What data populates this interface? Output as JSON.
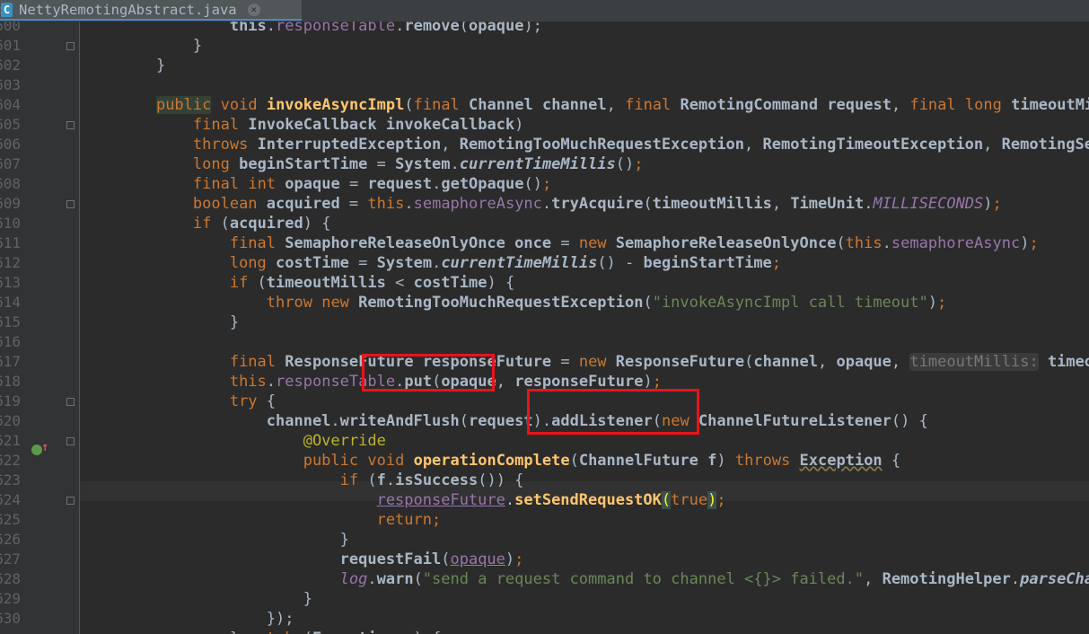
{
  "tab": {
    "file_icon": "C",
    "file_icon_name": "java-class-icon",
    "label": "NettyRemotingAbstract.java",
    "close": "×",
    "close_icon_name": "close-icon"
  },
  "line_numbers": [
    "600",
    "601",
    "602",
    "603",
    "604",
    "605",
    "606",
    "607",
    "608",
    "609",
    "610",
    "611",
    "612",
    "613",
    "614",
    "615",
    "616",
    "617",
    "618",
    "619",
    "620",
    "621",
    "622",
    "623",
    "624",
    "625",
    "626",
    "627",
    "628",
    "629",
    "630"
  ],
  "gutter": {
    "override_marker_icon": "override-method-icon"
  },
  "theme": {
    "background": "#2b2b2b",
    "keyword": "#cc7832",
    "field": "#9876aa",
    "string": "#6a8759",
    "method": "#ffc66d",
    "annotation": "#bbb529",
    "annotation_box": "#e8141a"
  },
  "code_lines": [
    [
      [
        "",
        "            "
      ],
      [
        "",
        "this"
      ],
      [
        "",
        "."
      ],
      [
        "f",
        "responseTable"
      ],
      [
        "",
        "."
      ],
      [
        "",
        "remove"
      ],
      [
        "",
        "("
      ],
      [
        "",
        "opaque"
      ],
      [
        "",
        ");"
      ]
    ],
    [
      [
        "",
        "        }"
      ]
    ],
    [
      [
        "",
        "    }"
      ]
    ],
    [],
    [
      [
        "",
        "    "
      ],
      [
        "k hl",
        "public"
      ],
      [
        "",
        " "
      ],
      [
        "k",
        "void"
      ],
      [
        "",
        " "
      ],
      [
        "m",
        "invokeAsyncImpl"
      ],
      [
        "",
        "("
      ],
      [
        "k",
        "final"
      ],
      [
        "",
        " "
      ],
      [
        "",
        "Channel"
      ],
      [
        "",
        " "
      ],
      [
        "",
        "channel"
      ],
      [
        "",
        ", "
      ],
      [
        "k",
        "final"
      ],
      [
        "",
        " "
      ],
      [
        "",
        "RemotingCommand"
      ],
      [
        "",
        " "
      ],
      [
        "",
        "request"
      ],
      [
        "",
        ", "
      ],
      [
        "k",
        "final"
      ],
      [
        "",
        " "
      ],
      [
        "k",
        "long"
      ],
      [
        "",
        " "
      ],
      [
        "",
        "timeoutMillis"
      ],
      [
        "",
        ","
      ]
    ],
    [
      [
        "",
        "        "
      ],
      [
        "k",
        "final"
      ],
      [
        "",
        " "
      ],
      [
        "",
        "InvokeCallback"
      ],
      [
        "",
        " "
      ],
      [
        "",
        "invokeCallback"
      ],
      [
        "",
        ")"
      ]
    ],
    [
      [
        "",
        "        "
      ],
      [
        "k",
        "throws"
      ],
      [
        "",
        " "
      ],
      [
        "",
        "InterruptedException"
      ],
      [
        "",
        ", "
      ],
      [
        "",
        "RemotingTooMuchRequestException"
      ],
      [
        "",
        ", "
      ],
      [
        "",
        "RemotingTimeoutException"
      ],
      [
        "",
        ", "
      ],
      [
        "",
        "RemotingSendRequestException"
      ],
      [
        "",
        " {"
      ]
    ],
    [
      [
        "",
        "        "
      ],
      [
        "k",
        "long"
      ],
      [
        "",
        " "
      ],
      [
        "",
        "beginStartTime"
      ],
      [
        "",
        " = "
      ],
      [
        "",
        "System"
      ],
      [
        "",
        "."
      ],
      [
        "it",
        "currentTimeMillis"
      ],
      [
        "",
        "()"
      ],
      [
        "k",
        ";"
      ]
    ],
    [
      [
        "",
        "        "
      ],
      [
        "k",
        "final"
      ],
      [
        "",
        " "
      ],
      [
        "k",
        "int"
      ],
      [
        "",
        " "
      ],
      [
        "",
        "opaque"
      ],
      [
        "",
        " = "
      ],
      [
        "",
        "request"
      ],
      [
        "",
        "."
      ],
      [
        "",
        "getOpaque"
      ],
      [
        "",
        "()"
      ],
      [
        "k",
        ";"
      ]
    ],
    [
      [
        "",
        "        "
      ],
      [
        "k",
        "boolean"
      ],
      [
        "",
        " "
      ],
      [
        "",
        "acquired"
      ],
      [
        "",
        " = "
      ],
      [
        "k",
        "this"
      ],
      [
        "",
        "."
      ],
      [
        "f",
        "semaphoreAsync"
      ],
      [
        "",
        "."
      ],
      [
        "",
        "tryAcquire"
      ],
      [
        "",
        "("
      ],
      [
        "",
        "timeoutMillis"
      ],
      [
        "",
        ", "
      ],
      [
        "",
        "TimeUnit"
      ],
      [
        "",
        "."
      ],
      [
        "sf",
        "MILLISECONDS"
      ],
      [
        "",
        ")"
      ],
      [
        "k",
        ";"
      ]
    ],
    [
      [
        "",
        "        "
      ],
      [
        "k",
        "if"
      ],
      [
        "",
        " ("
      ],
      [
        "",
        "acquired"
      ],
      [
        "",
        ") {"
      ]
    ],
    [
      [
        "",
        "            "
      ],
      [
        "k",
        "final"
      ],
      [
        "",
        " "
      ],
      [
        "",
        "SemaphoreReleaseOnlyOnce"
      ],
      [
        "",
        " "
      ],
      [
        "",
        "once"
      ],
      [
        "",
        " = "
      ],
      [
        "k",
        "new"
      ],
      [
        "",
        " "
      ],
      [
        "",
        "SemaphoreReleaseOnlyOnce"
      ],
      [
        "",
        "("
      ],
      [
        "k",
        "this"
      ],
      [
        "",
        "."
      ],
      [
        "f",
        "semaphoreAsync"
      ],
      [
        "",
        ")"
      ],
      [
        "k",
        ";"
      ]
    ],
    [
      [
        "",
        "            "
      ],
      [
        "k",
        "long"
      ],
      [
        "",
        " "
      ],
      [
        "",
        "costTime"
      ],
      [
        "",
        " = "
      ],
      [
        "",
        "System"
      ],
      [
        "",
        "."
      ],
      [
        "it",
        "currentTimeMillis"
      ],
      [
        "",
        "() - "
      ],
      [
        "",
        "beginStartTime"
      ],
      [
        "k",
        ";"
      ]
    ],
    [
      [
        "",
        "            "
      ],
      [
        "k",
        "if"
      ],
      [
        "",
        " ("
      ],
      [
        "",
        "timeoutMillis"
      ],
      [
        "",
        " < "
      ],
      [
        "",
        "costTime"
      ],
      [
        "",
        ") {"
      ]
    ],
    [
      [
        "",
        "                "
      ],
      [
        "k",
        "throw"
      ],
      [
        "",
        " "
      ],
      [
        "k",
        "new"
      ],
      [
        "",
        " "
      ],
      [
        "",
        "RemotingTooMuchRequestException"
      ],
      [
        "",
        "("
      ],
      [
        "s",
        "\"invokeAsyncImpl call timeout\""
      ],
      [
        "",
        ")"
      ],
      [
        "k",
        ";"
      ]
    ],
    [
      [
        "",
        "            }"
      ]
    ],
    [],
    [
      [
        "",
        "            "
      ],
      [
        "k",
        "final"
      ],
      [
        "",
        " "
      ],
      [
        "",
        "ResponseFuture"
      ],
      [
        "",
        " "
      ],
      [
        "",
        "responseFuture"
      ],
      [
        "",
        " = "
      ],
      [
        "k",
        "new"
      ],
      [
        "",
        " "
      ],
      [
        "",
        "ResponseFuture"
      ],
      [
        "",
        "("
      ],
      [
        "",
        "channel"
      ],
      [
        "",
        ", "
      ],
      [
        "",
        "opaque"
      ],
      [
        "",
        ", "
      ],
      [
        "hint",
        "timeoutMillis:"
      ],
      [
        "",
        " "
      ],
      [
        "",
        "timeoutMillis"
      ]
    ],
    [
      [
        "",
        "            "
      ],
      [
        "k",
        "this"
      ],
      [
        "",
        "."
      ],
      [
        "f",
        "responseTable"
      ],
      [
        "",
        "."
      ],
      [
        "",
        "put"
      ],
      [
        "",
        "("
      ],
      [
        "",
        "opaque"
      ],
      [
        "",
        ", "
      ],
      [
        "",
        "responseFuture"
      ],
      [
        "",
        ")"
      ],
      [
        "k",
        ";"
      ]
    ],
    [
      [
        "",
        "            "
      ],
      [
        "k",
        "try"
      ],
      [
        "",
        " {"
      ]
    ],
    [
      [
        "",
        "                "
      ],
      [
        "",
        "channel"
      ],
      [
        "",
        "."
      ],
      [
        "",
        "writeAndFlush"
      ],
      [
        "",
        "("
      ],
      [
        "",
        "request"
      ],
      [
        "",
        ")."
      ],
      [
        "",
        "addListener"
      ],
      [
        "",
        "("
      ],
      [
        "k",
        "new"
      ],
      [
        "",
        " "
      ],
      [
        "",
        "ChannelFutureListener"
      ],
      [
        "",
        "() {"
      ]
    ],
    [
      [
        "",
        "                    "
      ],
      [
        "ann",
        "@Override"
      ]
    ],
    [
      [
        "",
        "                    "
      ],
      [
        "k",
        "public"
      ],
      [
        "",
        " "
      ],
      [
        "k",
        "void"
      ],
      [
        "",
        " "
      ],
      [
        "m",
        "operationComplete"
      ],
      [
        "",
        "("
      ],
      [
        "",
        "ChannelFuture"
      ],
      [
        "",
        " "
      ],
      [
        "",
        "f"
      ],
      [
        "",
        ") "
      ],
      [
        "k",
        "throws"
      ],
      [
        "",
        " "
      ],
      [
        "wrn",
        "Exception"
      ],
      [
        "",
        " {"
      ]
    ],
    [
      [
        "",
        "                        "
      ],
      [
        "k",
        "if"
      ],
      [
        "",
        " ("
      ],
      [
        "",
        "f"
      ],
      [
        "",
        "."
      ],
      [
        "",
        "isSuccess"
      ],
      [
        "",
        "()) {"
      ]
    ],
    [
      [
        "",
        "                            "
      ],
      [
        "f ul",
        "responseFuture"
      ],
      [
        "",
        "."
      ],
      [
        "m",
        "setSendRequestOK"
      ],
      [
        "bm",
        "("
      ],
      [
        "k",
        "true"
      ],
      [
        "bm",
        ")"
      ],
      [
        "k",
        ";"
      ]
    ],
    [
      [
        "",
        "                            "
      ],
      [
        "k",
        "return"
      ],
      [
        "k",
        ";"
      ]
    ],
    [
      [
        "",
        "                        }"
      ]
    ],
    [
      [
        "",
        "                        "
      ],
      [
        "",
        "requestFail"
      ],
      [
        "",
        "("
      ],
      [
        "f ul",
        "opaque"
      ],
      [
        "",
        ")"
      ],
      [
        "k",
        ";"
      ]
    ],
    [
      [
        "",
        "                        "
      ],
      [
        "sf",
        "log"
      ],
      [
        "",
        "."
      ],
      [
        "",
        "warn"
      ],
      [
        "",
        "("
      ],
      [
        "s",
        "\"send a request command to channel <{}> failed.\""
      ],
      [
        "",
        ", "
      ],
      [
        "",
        "RemotingHelper"
      ],
      [
        "",
        "."
      ],
      [
        "it",
        "parseChannelRemoteAddr"
      ],
      [
        "",
        "("
      ]
    ],
    [
      [
        "",
        "                    }"
      ]
    ],
    [
      [
        "",
        "                });"
      ]
    ],
    [
      [
        "",
        "            } "
      ],
      [
        "k",
        "catch"
      ],
      [
        "",
        " ("
      ],
      [
        "",
        "Exception"
      ],
      [
        "",
        " "
      ],
      [
        "",
        "e"
      ],
      [
        "",
        ") {"
      ]
    ]
  ],
  "fold_marker_lines": [
    1,
    5,
    9,
    19,
    21,
    24
  ]
}
